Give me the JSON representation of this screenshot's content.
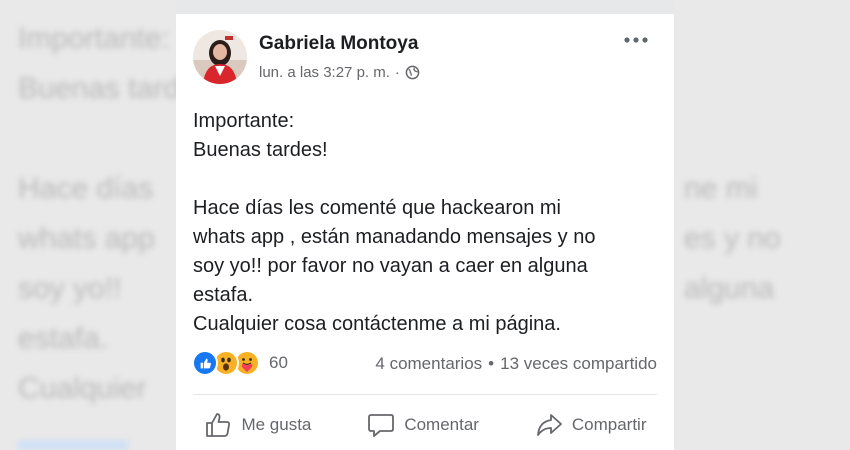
{
  "post": {
    "author": "Gabriela Montoya",
    "timestamp": "lun. a las 3:27 p. m.",
    "separator": "·",
    "privacy_icon": "globe-icon",
    "more_icon": "more-options-icon",
    "text_lines": [
      "Importante:",
      "Buenas tardes!",
      "",
      "Hace días les comenté que hackearon mi",
      "whats app , están manadando mensajes y no",
      "soy yo!! por favor no vayan a caer en alguna",
      "estafa.",
      "Cualquier cosa contáctenme a mi página."
    ],
    "reactions": {
      "icons": [
        "like-reaction-icon",
        "wow-reaction-icon",
        "care-reaction-icon"
      ],
      "count": "60"
    },
    "comments": "4 comentarios",
    "stat_separator": "•",
    "shares": "13 veces compartido"
  },
  "actions": {
    "like": "Me gusta",
    "comment": "Comentar",
    "share": "Compartir"
  },
  "background": {
    "left_lines": [
      "Importante:",
      "Buenas tardes!",
      "Hace días",
      "whats app",
      "soy yo!!",
      "estafa.",
      "Cualquier"
    ],
    "right_lines": [
      "ne mi",
      "es y no",
      "alguna"
    ]
  },
  "colors": {
    "text": "#1c1e21",
    "secondary": "#65676b",
    "like_blue": "#1877f2",
    "wow_yellow": "#f7b125"
  }
}
